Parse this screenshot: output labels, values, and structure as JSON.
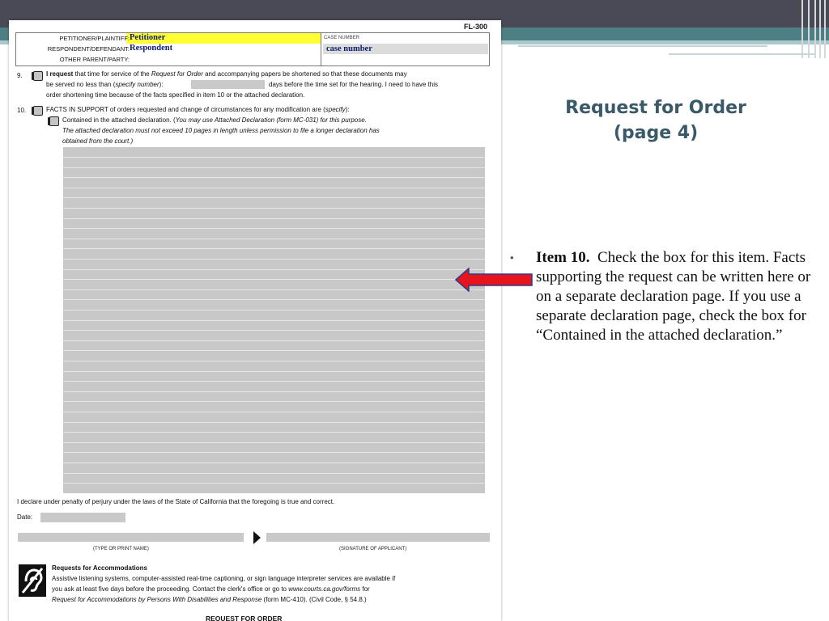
{
  "slide": {
    "title_line1": "Request for Order",
    "title_line2": "(page 4)",
    "bullet_marker": "•",
    "bullet_bold": "Item 10.",
    "bullet_text": "Check the box for this item.  Facts supporting the request can be written here or on a separate declaration page.  If you use a separate declaration page, check the box for “Contained in the attached declaration.”",
    "colors": {
      "top_bar": "#4a4a57",
      "teal_band": "#4d7f84",
      "title": "#3a5a6a",
      "arrow": "#e8141c"
    }
  },
  "form": {
    "form_number": "FL-300",
    "header": {
      "petitioner_label": "PETITIONER/PLAINTIFF:",
      "respondent_label": "RESPONDENT/DEFENDANT:",
      "other_label": "OTHER PARENT/PARTY:",
      "petitioner_value": "Petitioner",
      "respondent_value": "Respondent",
      "case_number_label": "CASE NUMBER",
      "case_number_value": "case number"
    },
    "item9": {
      "number": "9.",
      "line1_bold": "I request",
      "line1_a": " that time for service of the ",
      "line1_italic": "Request for Order",
      "line1_b": " and accompanying papers be shortened so that these documents may",
      "line2_a": "be served no less than (",
      "line2_italic": "specify number",
      "line2_b": "):",
      "line2_c": "days before the time set for the hearing. I need to have this",
      "line3": "order shortening time because of the facts specified in item 10 or the attached declaration."
    },
    "item10": {
      "number": "10.",
      "line1_a": "FACTS IN SUPPORT of orders requested and change of circumstances for any modification are (",
      "line1_italic": "specify",
      "line1_b": "):",
      "contained_a": "Contained in the attached declaration. (",
      "contained_italic_a": "You may use Attached Declaration (form MC-031) for this purpose.",
      "limit_line1": "The attached declaration must not exceed 10 pages in length unless permission to file a longer declaration has",
      "limit_line2": "obtained from the court.)"
    },
    "perjury": "I declare under penalty of perjury under the laws of the State of California that the foregoing is true and correct.",
    "date_label": "Date:",
    "print_name_label": "(TYPE OR PRINT NAME)",
    "signature_label": "(SIGNATURE OF APPLICANT)",
    "accommodations": {
      "title": "Requests for Accommodations",
      "line1": "Assistive listening systems, computer-assisted real-time captioning, or sign language interpreter services are available if",
      "line2_a": "you ask at least five days before the proceeding. Contact the clerk's office or go to ",
      "line2_italic": "www.courts.ca.gov/forms",
      "line2_b": " for",
      "line3_italic": "Request for Accommodations by Persons With Disabilities and Response",
      "line3_b": " (form MC-410). (Civil Code, § 54.8.)"
    },
    "footer_title": "REQUEST FOR ORDER"
  }
}
